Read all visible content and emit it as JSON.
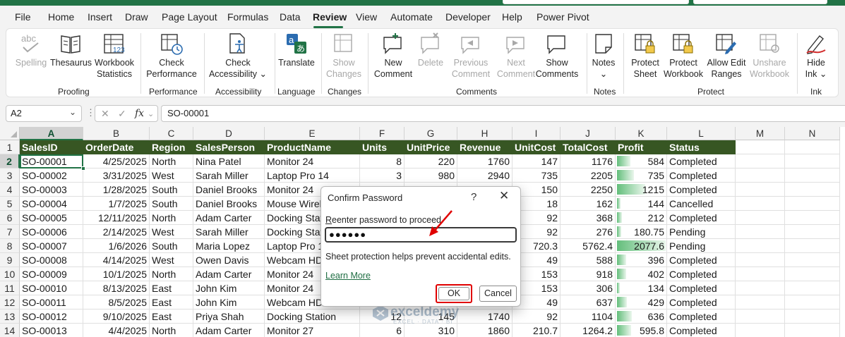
{
  "menu": {
    "items": [
      "File",
      "Home",
      "Insert",
      "Draw",
      "Page Layout",
      "Formulas",
      "Data",
      "Review",
      "View",
      "Automate",
      "Developer",
      "Help",
      "Power Pivot"
    ],
    "active": "Review"
  },
  "ribbon": {
    "buttons": {
      "spelling": {
        "line1": "Spelling",
        "line2": "",
        "icon": "spelling-abc-icon"
      },
      "thesaurus": {
        "line1": "Thesaurus",
        "line2": "",
        "icon": "book-icon"
      },
      "workbook_statistics": {
        "line1": "Workbook",
        "line2": "Statistics",
        "icon": "statistics-icon"
      },
      "check_performance": {
        "line1": "Check",
        "line2": "Performance",
        "icon": "performance-icon"
      },
      "check_accessibility": {
        "line1": "Check",
        "line2": "Accessibility",
        "icon": "accessibility-icon"
      },
      "translate": {
        "line1": "Translate",
        "line2": "",
        "icon": "translate-icon"
      },
      "show_changes": {
        "line1": "Show",
        "line2": "Changes",
        "icon": "show-changes-icon"
      },
      "new_comment": {
        "line1": "New",
        "line2": "Comment",
        "icon": "new-comment-icon"
      },
      "delete": {
        "line1": "Delete",
        "line2": "",
        "icon": "delete-comment-icon"
      },
      "previous_comment": {
        "line1": "Previous",
        "line2": "Comment",
        "icon": "previous-comment-icon"
      },
      "next_comment": {
        "line1": "Next",
        "line2": "Comment",
        "icon": "next-comment-icon"
      },
      "show_comments": {
        "line1": "Show",
        "line2": "Comments",
        "icon": "show-comments-icon"
      },
      "notes": {
        "line1": "Notes",
        "line2": "",
        "icon": "notes-icon"
      },
      "protect_sheet": {
        "line1": "Protect",
        "line2": "Sheet",
        "icon": "protect-sheet-icon"
      },
      "protect_workbook": {
        "line1": "Protect",
        "line2": "Workbook",
        "icon": "protect-workbook-icon"
      },
      "allow_edit_ranges": {
        "line1": "Allow Edit",
        "line2": "Ranges",
        "icon": "allow-edit-ranges-icon"
      },
      "unshare_workbook": {
        "line1": "Unshare",
        "line2": "Workbook",
        "icon": "unshare-workbook-icon"
      },
      "hide_ink": {
        "line1": "Hide",
        "line2": "Ink",
        "icon": "hide-ink-icon"
      }
    },
    "groups": {
      "proofing": "Proofing",
      "performance": "Performance",
      "accessibility": "Accessibility",
      "language": "Language",
      "changes": "Changes",
      "comments": "Comments",
      "notes": "Notes",
      "protect": "Protect",
      "ink": "Ink"
    }
  },
  "formula_bar": {
    "name_box": "A2",
    "fx_label": "fx",
    "formula": "SO-00001"
  },
  "sheet": {
    "columns": [
      "A",
      "B",
      "C",
      "D",
      "E",
      "F",
      "G",
      "H",
      "I",
      "J",
      "K",
      "L",
      "M",
      "N"
    ],
    "rows": [
      "1",
      "2",
      "3",
      "4",
      "5",
      "6",
      "7",
      "8",
      "9",
      "10",
      "11",
      "12",
      "13",
      "14"
    ],
    "selected_column": "A",
    "selected_row": "2",
    "header": [
      "SalesID",
      "OrderDate",
      "Region",
      "SalesPerson",
      "ProductName",
      "Units",
      "UnitPrice",
      "Revenue",
      "UnitCost",
      "TotalCost",
      "Profit",
      "Status"
    ],
    "data": [
      [
        "SO-00001",
        "4/25/2025",
        "North",
        "Nina Patel",
        "Monitor 24",
        "8",
        "220",
        "1760",
        "147",
        "1176",
        "584",
        "Completed"
      ],
      [
        "SO-00002",
        "3/31/2025",
        "West",
        "Sarah Miller",
        "Laptop Pro 14",
        "3",
        "980",
        "2940",
        "735",
        "2205",
        "735",
        "Completed"
      ],
      [
        "SO-00003",
        "1/28/2025",
        "South",
        "Daniel Brooks",
        "Monitor 24",
        "",
        "",
        "",
        "150",
        "2250",
        "1215",
        "Completed"
      ],
      [
        "SO-00004",
        "1/7/2025",
        "South",
        "Daniel Brooks",
        "Mouse Wireless",
        "",
        "",
        "",
        "18",
        "162",
        "144",
        "Cancelled"
      ],
      [
        "SO-00005",
        "12/11/2025",
        "North",
        "Adam Carter",
        "Docking Station",
        "",
        "",
        "",
        "92",
        "368",
        "212",
        "Completed"
      ],
      [
        "SO-00006",
        "2/14/2025",
        "West",
        "Sarah Miller",
        "Docking Station",
        "",
        "",
        "",
        "92",
        "276",
        "180.75",
        "Pending"
      ],
      [
        "SO-00007",
        "1/6/2026",
        "South",
        "Maria Lopez",
        "Laptop Pro 14",
        "",
        "",
        "",
        "720.3",
        "5762.4",
        "2077.6",
        "Pending"
      ],
      [
        "SO-00008",
        "4/14/2025",
        "West",
        "Owen Davis",
        "Webcam HD",
        "",
        "",
        "",
        "49",
        "588",
        "396",
        "Completed"
      ],
      [
        "SO-00009",
        "10/1/2025",
        "North",
        "Adam Carter",
        "Monitor 24",
        "",
        "",
        "",
        "153",
        "918",
        "402",
        "Completed"
      ],
      [
        "SO-00010",
        "8/13/2025",
        "East",
        "John Kim",
        "Monitor 24",
        "",
        "",
        "",
        "153",
        "306",
        "134",
        "Completed"
      ],
      [
        "SO-00011",
        "8/5/2025",
        "East",
        "John Kim",
        "Webcam HD",
        "",
        "",
        "",
        "49",
        "637",
        "429",
        "Completed"
      ],
      [
        "SO-00012",
        "9/10/2025",
        "East",
        "Priya Shah",
        "Docking Station",
        "12",
        "145",
        "1740",
        "92",
        "1104",
        "636",
        "Completed"
      ],
      [
        "SO-00013",
        "4/4/2025",
        "North",
        "Adam Carter",
        "Monitor 27",
        "6",
        "310",
        "1860",
        "210.7",
        "1264.2",
        "595.8",
        "Completed"
      ]
    ],
    "profit_bar_fraction": [
      0.28,
      0.35,
      0.58,
      0.07,
      0.1,
      0.09,
      1.0,
      0.19,
      0.19,
      0.06,
      0.21,
      0.31,
      0.29
    ],
    "header_color": "#375623",
    "databar_color": "#63be7b"
  },
  "dialog": {
    "title": "Confirm Password",
    "help": "?",
    "close": "✕",
    "prompt_accel": "R",
    "prompt_rest": "eenter password to proceed.",
    "password_mask": "●●●●●●",
    "note": "Sheet protection helps prevent accidental edits.",
    "learn_more": "Learn More",
    "ok": "OK",
    "cancel": "Cancel",
    "highlight_color": "#e00000"
  },
  "watermark": {
    "brand": "exceldemy",
    "tagline": "EXCEL · DATA · BI"
  }
}
